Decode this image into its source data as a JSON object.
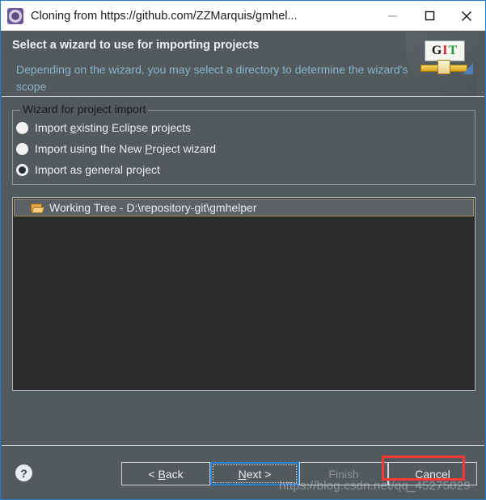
{
  "window": {
    "title": "Cloning from https://github.com/ZZMarquis/gmhel...",
    "icon": "git-repository-icon",
    "controls": {
      "minimize": "minimize-icon",
      "maximize": "maximize-icon",
      "close": "close-icon"
    }
  },
  "header": {
    "title": "Select a wizard to use for importing projects",
    "description": "Depending on the wizard, you may select a directory to determine the wizard's scope",
    "logo": {
      "name": "git-banner-logo",
      "letters": {
        "g": "G",
        "i": "I",
        "t": "T"
      }
    },
    "colors": {
      "background": "#525a5e",
      "title_text": "#eceff0",
      "description_text": "#89b4c9"
    }
  },
  "group": {
    "legend": "Wizard for project import",
    "options": [
      {
        "label_before": "Import ",
        "accel": "e",
        "label_after": "xisting Eclipse projects",
        "selected": false,
        "name": "radio-import-existing-eclipse-projects"
      },
      {
        "label_before": "Import using the New ",
        "accel": "P",
        "label_after": "roject wizard",
        "selected": false,
        "name": "radio-import-new-project-wizard"
      },
      {
        "label_before": "Import as ",
        "accel": "g",
        "label_after": "eneral project",
        "selected": true,
        "name": "radio-import-general-project"
      }
    ]
  },
  "tree": {
    "items": [
      {
        "label": "Working Tree - D:\\repository-git\\gmhelper",
        "icon": "folder-open-icon",
        "selected": true
      }
    ]
  },
  "footer": {
    "help": "?",
    "buttons": [
      {
        "name": "back-button",
        "before": "< ",
        "accel": "B",
        "after": "ack",
        "enabled": true,
        "focused": false
      },
      {
        "name": "next-button",
        "before": "",
        "accel": "N",
        "after": "ext >",
        "enabled": true,
        "focused": true
      },
      {
        "name": "finish-button",
        "before": "Fini",
        "accel": "",
        "after": "sh",
        "enabled": false,
        "focused": false
      },
      {
        "name": "cancel-button",
        "before": "Canc",
        "accel": "",
        "after": "el",
        "enabled": true,
        "focused": false
      }
    ]
  },
  "annotation": {
    "target": "cancel-button",
    "color": "#f93a34"
  },
  "watermark": {
    "text": "https://blog.csdn.net/qq_45275029"
  }
}
